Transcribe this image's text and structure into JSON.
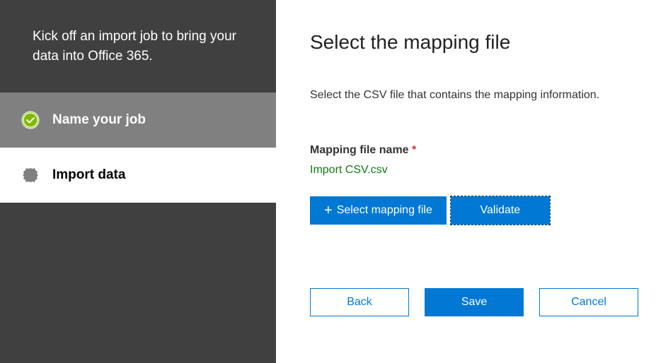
{
  "sidebar": {
    "intro": "Kick off an import job to bring your data into Office 365.",
    "steps": [
      {
        "label": "Name your job"
      },
      {
        "label": "Import data"
      }
    ]
  },
  "main": {
    "title": "Select the mapping file",
    "subtitle": "Select the CSV file that contains the mapping information.",
    "field_label": "Mapping file name",
    "required_mark": "*",
    "file_name": "Import CSV.csv",
    "select_file_label": "Select mapping file",
    "validate_label": "Validate",
    "back_label": "Back",
    "save_label": "Save",
    "cancel_label": "Cancel"
  }
}
